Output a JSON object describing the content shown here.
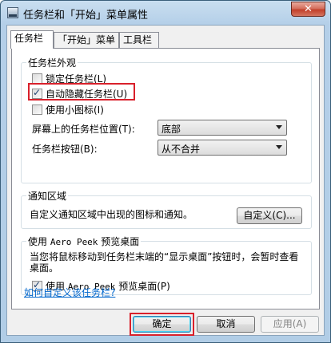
{
  "window": {
    "title": "任务栏和「开始」菜单属性",
    "close_glyph": "✕"
  },
  "tabs": [
    {
      "label": "任务栏",
      "active": true
    },
    {
      "label": "「开始」菜单",
      "active": false
    },
    {
      "label": "工具栏",
      "active": false
    }
  ],
  "appearance": {
    "group_title": "任务栏外观",
    "lock_taskbar": {
      "label": "锁定任务栏(L)",
      "checked": false
    },
    "auto_hide": {
      "label": "自动隐藏任务栏(U)",
      "checked": true
    },
    "small_icons": {
      "label": "使用小图标(I)",
      "checked": false
    },
    "location_label": "屏幕上的任务栏位置(T):",
    "location_value": "底部",
    "buttons_label": "任务栏按钮(B):",
    "buttons_value": "从不合并"
  },
  "notification": {
    "group_title": "通知区域",
    "description": "自定义通知区域中出现的图标和通知。",
    "customize_button": "自定义(C)..."
  },
  "aero_peek": {
    "group_title_prefix": "使用 ",
    "group_title_mono": "Aero Peek",
    "group_title_suffix": " 预览桌面",
    "description": "当您将鼠标移动到任务栏末端的“显示桌面”按钮时，会暂时查看桌面。",
    "checkbox_prefix": "使用 ",
    "checkbox_mono": "Aero Peek",
    "checkbox_suffix": " 预览桌面(P)",
    "checked": true
  },
  "help_link": "如何自定义该任务栏?",
  "footer": {
    "ok": "确定",
    "cancel": "取消",
    "apply": "应用(A)"
  }
}
